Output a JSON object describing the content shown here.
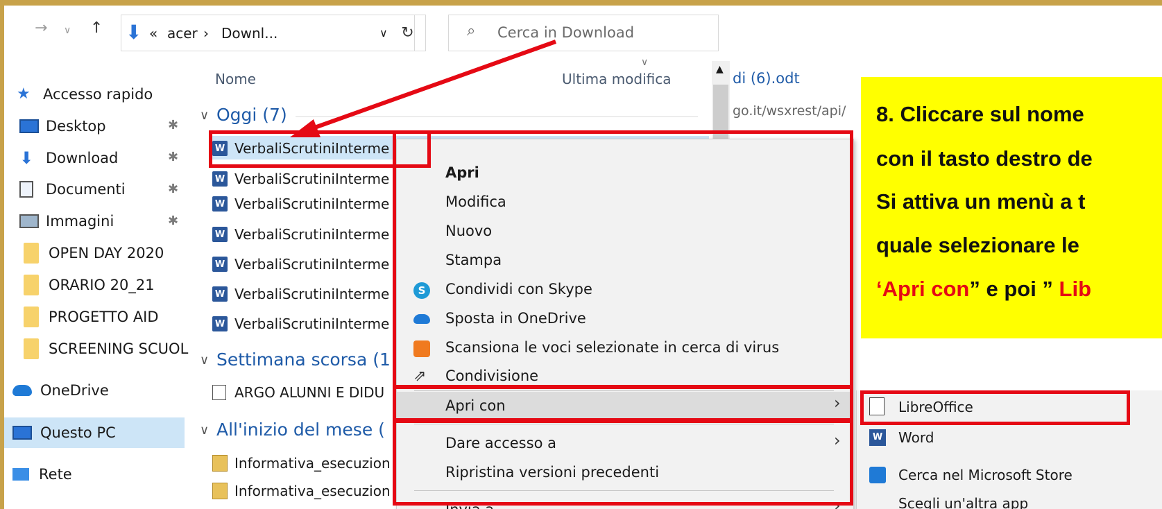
{
  "address_bar": {
    "crumb_prefix": "«",
    "crumb_user": "acer",
    "crumb_sep": "›",
    "crumb_folder": "Downl...",
    "search_placeholder": "Cerca in Download"
  },
  "columns": {
    "name": "Nome",
    "modified": "Ultima modifica"
  },
  "background_text": {
    "file_name": "di (6).odt",
    "url": "go.it/wsxrest/api/"
  },
  "nav_pane": {
    "items": [
      {
        "label": "Accesso rapido",
        "icon": "star-icon"
      },
      {
        "label": "Desktop",
        "icon": "desktop-icon",
        "pinned": true
      },
      {
        "label": "Download",
        "icon": "download-icon",
        "pinned": true
      },
      {
        "label": "Documenti",
        "icon": "documents-icon",
        "pinned": true
      },
      {
        "label": "Immagini",
        "icon": "images-icon",
        "pinned": true
      },
      {
        "label": "OPEN DAY 2020",
        "icon": "folder-icon"
      },
      {
        "label": "ORARIO 20_21",
        "icon": "folder-icon"
      },
      {
        "label": "PROGETTO AID",
        "icon": "folder-icon"
      },
      {
        "label": "SCREENING SCUOL",
        "icon": "folder-icon"
      },
      {
        "label": "OneDrive",
        "icon": "onedrive-icon"
      },
      {
        "label": "Questo PC",
        "icon": "pc-icon",
        "selected": true
      },
      {
        "label": "Rete",
        "icon": "network-icon"
      }
    ]
  },
  "groups": {
    "today": "Oggi (7)",
    "last_week": "Settimana scorsa (1",
    "this_month": "All'inizio del mese ("
  },
  "files": {
    "today": [
      "VerbaliScrutiniInterme",
      "VerbaliScrutiniInterme",
      "VerbaliScrutiniInterme",
      "VerbaliScrutiniInterme",
      "VerbaliScrutiniInterme",
      "VerbaliScrutiniInterme",
      "VerbaliScrutiniInterme"
    ],
    "last_week": [
      "ARGO ALUNNI E DIDU"
    ],
    "this_month": [
      "Informativa_esecuzion",
      "Informativa_esecuzion"
    ]
  },
  "context_menu": {
    "open": "Apri",
    "edit": "Modifica",
    "new": "Nuovo",
    "print": "Stampa",
    "skype": "Condividi con Skype",
    "onedrive": "Sposta in OneDrive",
    "scan": "Scansiona le voci selezionate in cerca di virus",
    "share": "Condivisione",
    "open_with": "Apri con",
    "give_access": "Dare accesso a",
    "restore": "Ripristina versioni precedenti",
    "send_to": "Invia a"
  },
  "submenu": {
    "libreoffice": "LibreOffice",
    "word": "Word",
    "store": "Cerca nel Microsoft Store",
    "other": "Scegli un'altra app"
  },
  "callout": {
    "line1": "8. Cliccare sul nome",
    "line2": "con il tasto destro de",
    "line3": "Si attiva un menù a t",
    "line4": "quale selezionare le",
    "line5_part1": "‘",
    "line5_red1": "Apri con",
    "line5_part2": "” e poi ” ",
    "line5_red2": "Lib"
  },
  "colors": {
    "highlight": "#e50914",
    "callout_bg": "#ffff00",
    "frame": "#c8a24a",
    "group_blue": "#1f5ba8"
  }
}
